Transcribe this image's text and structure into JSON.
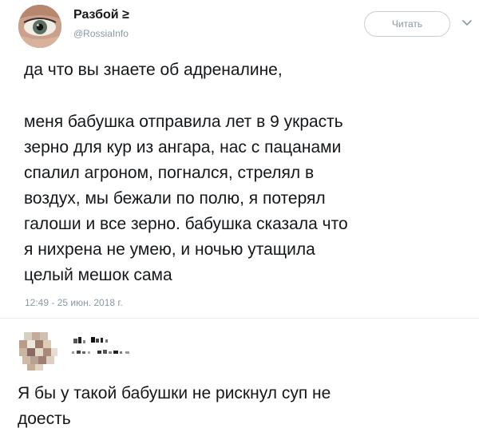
{
  "tweet": {
    "display_name": "Разбой ≥",
    "username": "@RossiaInfo",
    "follow_label": "Читать",
    "text_lines_first": [
      "да что вы знаете об адреналине,"
    ],
    "text_lines_second": [
      "меня бабушка отправила лет в 9 украсть",
      "зерно для кур из ангара, нас с пацанами",
      "спалил агроном, погнался, стрелял в",
      "воздух, мы бежали по полю, я потерял",
      "галоши и все зерно. бабушка сказала что",
      "я нихрена не умею, и ночью утащила",
      "целый мешок сама"
    ],
    "timestamp": "12:49 - 25 июн. 2018 г."
  },
  "reply": {
    "text_lines": [
      "Я бы у такой бабушки не рискнул суп не",
      "доесть"
    ]
  },
  "icons": {
    "avatar": "eye-avatar",
    "chevron": "chevron-down-icon",
    "reply_avatar": "pixelated-avatar",
    "reply_name": "pixelated-name"
  },
  "colors": {
    "text": "#14171a",
    "muted": "#8899a6",
    "border": "#c7cfd6"
  }
}
